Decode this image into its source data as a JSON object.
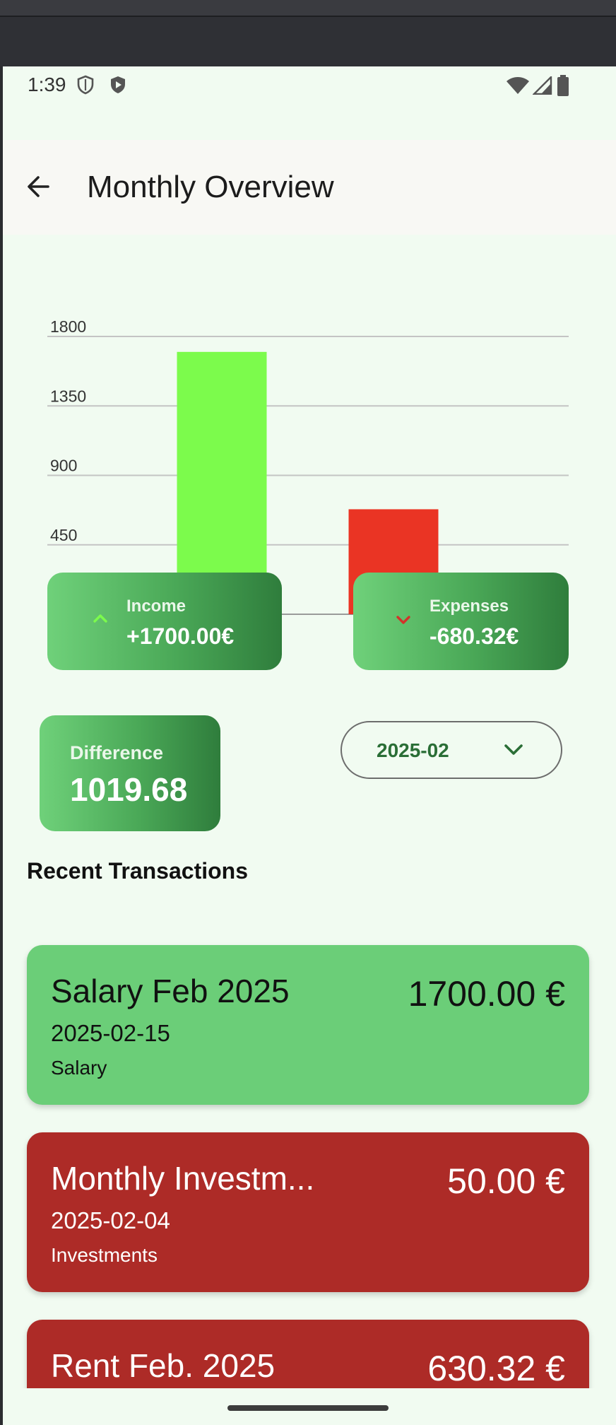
{
  "status_bar": {
    "time": "1:39"
  },
  "app_bar": {
    "title": "Monthly Overview",
    "back_icon": "arrow-back-icon"
  },
  "chart_data": {
    "type": "bar",
    "categories": [
      "Income",
      "Expenses"
    ],
    "values": [
      1700.0,
      680.32
    ],
    "colors": [
      "#7cfb4c",
      "#ea3424"
    ],
    "yticks": [
      "0",
      "450",
      "900",
      "1350",
      "1800"
    ],
    "ylim": [
      0,
      1800
    ],
    "grid": true,
    "title": "",
    "xlabel": "",
    "ylabel": ""
  },
  "summary": {
    "income": {
      "label": "Income",
      "value": "+1700.00€",
      "icon": "chevron-up-icon",
      "icon_color": "#7cfb4c"
    },
    "expenses": {
      "label": "Expenses",
      "value": "-680.32€",
      "icon": "chevron-down-icon",
      "icon_color": "#d3322a"
    },
    "difference": {
      "label": "Difference",
      "value": "1019.68"
    }
  },
  "month_selector": {
    "value": "2025-02",
    "icon": "chevron-down-icon"
  },
  "recent": {
    "title": "Recent Transactions",
    "items": [
      {
        "title": "Salary Feb 2025",
        "date": "2025-02-15",
        "category": "Salary",
        "amount": "1700.00 €",
        "kind": "income"
      },
      {
        "title": "Monthly Investm...",
        "date": "2025-02-04",
        "category": "Investments",
        "amount": "50.00 €",
        "kind": "expense"
      },
      {
        "title": "Rent Feb. 2025",
        "date": "",
        "category": "",
        "amount": "630.32 €",
        "kind": "expense"
      }
    ]
  },
  "colors": {
    "background": "#f1fbf1",
    "income_card": "#6bce78",
    "expense_card": "#ad2b27",
    "accent_green": "#2f7d3c"
  }
}
